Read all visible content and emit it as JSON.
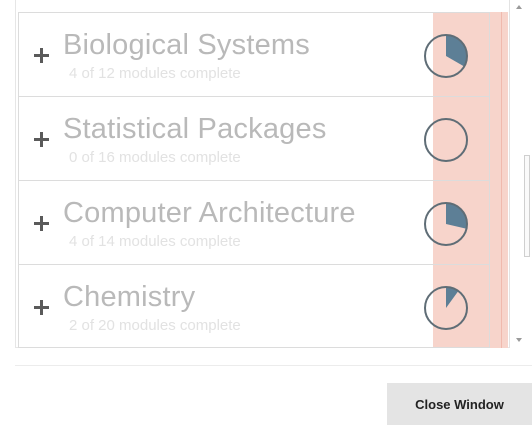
{
  "courses": [
    {
      "title": "Biological Systems",
      "subtitle": "4 of 12 modules complete",
      "progress": 0.333
    },
    {
      "title": "Statistical Packages",
      "subtitle": "0 of 16 modules complete",
      "progress": 0.0
    },
    {
      "title": "Computer Architecture",
      "subtitle": "4 of 14 modules complete",
      "progress": 0.286
    },
    {
      "title": "Chemistry",
      "subtitle": "2 of 20 modules complete",
      "progress": 0.1
    }
  ],
  "close_button_label": "Close Window",
  "colors": {
    "pie_fill": "#5d7f96",
    "pie_stroke": "#5f6d76",
    "highlight": "#f7d4cb"
  },
  "icons": {
    "expand": "plus-icon",
    "progress": "progress-pie-icon",
    "scroll_up": "chevron-up-icon",
    "scroll_down": "chevron-down-icon"
  }
}
